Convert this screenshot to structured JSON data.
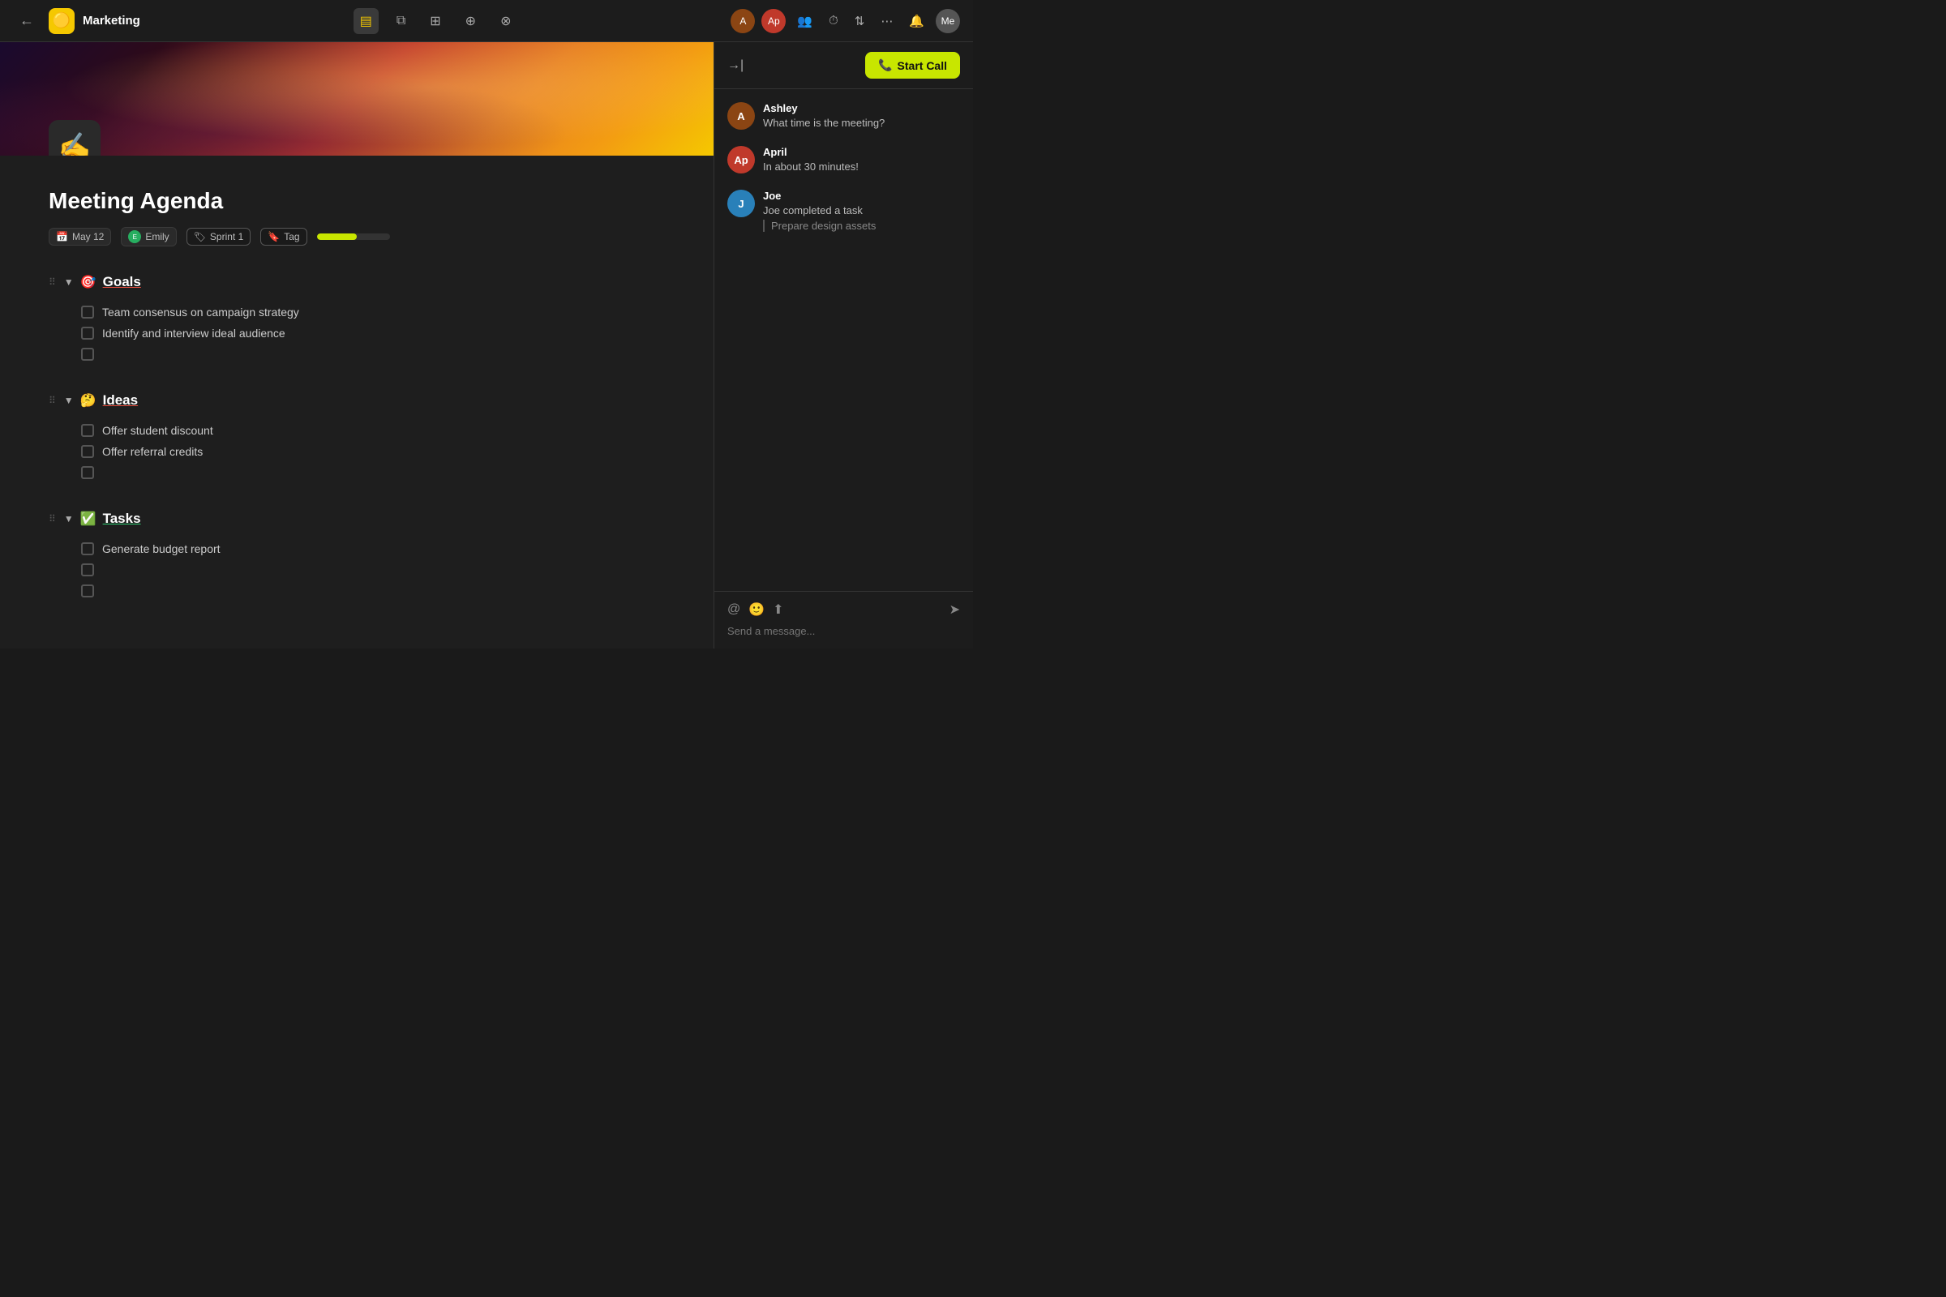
{
  "topnav": {
    "back_icon": "←",
    "logo_emoji": "🟡",
    "title": "Marketing",
    "toolbar_icons": [
      "▤",
      "⧉",
      "⊞",
      "⊕",
      "⊗"
    ],
    "right_icons": [
      "👥",
      "⏱",
      "⇅",
      "⋯",
      "🔔"
    ],
    "collapse_icon": "→|"
  },
  "hero": {
    "page_icon": "✍️"
  },
  "page": {
    "title": "Meeting Agenda",
    "meta": {
      "date": "May 12",
      "assignee": "Emily",
      "sprint": "Sprint 1",
      "tag": "Tag",
      "progress": 55
    }
  },
  "sections": [
    {
      "id": "goals",
      "emoji": "🎯",
      "title": "Goals",
      "underline_color": "#e74c3c",
      "tasks": [
        "Team consensus on campaign strategy",
        "Identify and interview ideal audience",
        ""
      ]
    },
    {
      "id": "ideas",
      "emoji": "🤔",
      "title": "Ideas",
      "underline_color": "#e74c3c",
      "tasks": [
        "Offer student discount",
        "Offer referral credits",
        ""
      ]
    },
    {
      "id": "tasks",
      "emoji": "✅",
      "title": "Tasks",
      "underline_color": "#2ecc71",
      "tasks": [
        "Generate budget report",
        "",
        ""
      ]
    }
  ],
  "panel": {
    "collapse_icon": "→|",
    "start_call_label": "Start Call",
    "phone_icon": "📞"
  },
  "chat": {
    "messages": [
      {
        "id": "ashley",
        "name": "Ashley",
        "avatar_label": "A",
        "avatar_class": "avatar-ashley",
        "type": "text",
        "text": "What time is the meeting?"
      },
      {
        "id": "april",
        "name": "April",
        "avatar_label": "Ap",
        "avatar_class": "avatar-april",
        "type": "text",
        "text": "In about 30 minutes!"
      },
      {
        "id": "joe",
        "name": "Joe",
        "avatar_label": "J",
        "avatar_class": "avatar-joe",
        "type": "task",
        "text": "Joe completed a task",
        "task_title": "Prepare design assets"
      }
    ],
    "input_placeholder": "Send a message...",
    "icons": {
      "mention": "@",
      "emoji": "🙂",
      "attach": "↑"
    }
  }
}
